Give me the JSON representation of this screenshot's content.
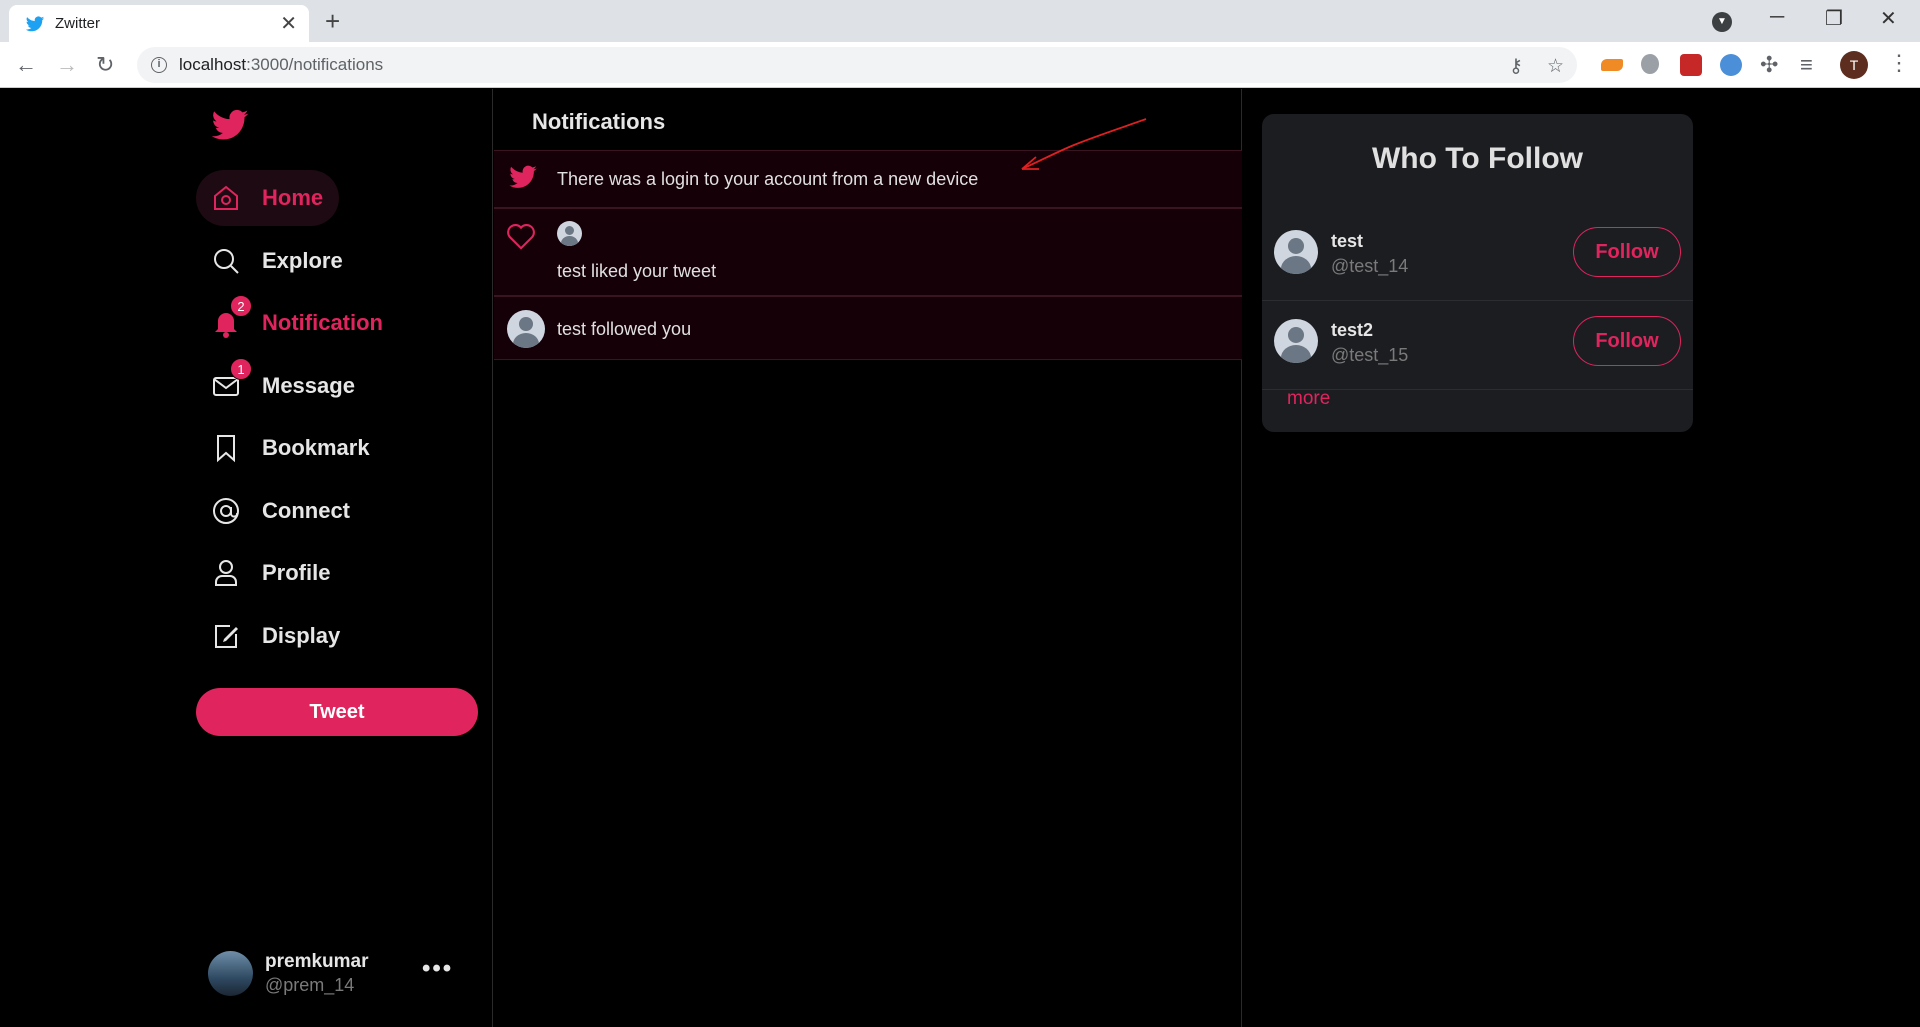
{
  "browser": {
    "tab_title": "Zwitter",
    "url_host": "localhost",
    "url_path": ":3000/notifications",
    "profile_initial": "T"
  },
  "sidebar": {
    "nav": [
      {
        "label": "Home",
        "icon": "home-icon",
        "active": true
      },
      {
        "label": "Explore",
        "icon": "search-icon"
      },
      {
        "label": "Notification",
        "icon": "bell-icon",
        "badge": "2",
        "active": true
      },
      {
        "label": "Message",
        "icon": "mail-icon",
        "badge": "1"
      },
      {
        "label": "Bookmark",
        "icon": "bookmark-icon"
      },
      {
        "label": "Connect",
        "icon": "at-icon"
      },
      {
        "label": "Profile",
        "icon": "user-icon"
      },
      {
        "label": "Display",
        "icon": "edit-icon"
      }
    ],
    "tweet_label": "Tweet",
    "user": {
      "name": "premkumar",
      "handle": "@prem_14"
    },
    "more": "•••"
  },
  "main": {
    "title": "Notifications",
    "notifications": [
      {
        "icon": "bird-icon",
        "text": "There was a login to your account from a new device"
      },
      {
        "icon": "heart-icon",
        "text": "test liked your tweet"
      },
      {
        "icon": "avatar",
        "text": "test followed you"
      }
    ]
  },
  "who_to_follow": {
    "title": "Who To Follow",
    "users": [
      {
        "name": "test",
        "handle": "@test_14",
        "button": "Follow"
      },
      {
        "name": "test2",
        "handle": "@test_15",
        "button": "Follow"
      }
    ],
    "more": "more"
  },
  "colors": {
    "accent": "#e0245e",
    "twitter_blue": "#1da1f2",
    "annotation_red": "#e02020"
  }
}
